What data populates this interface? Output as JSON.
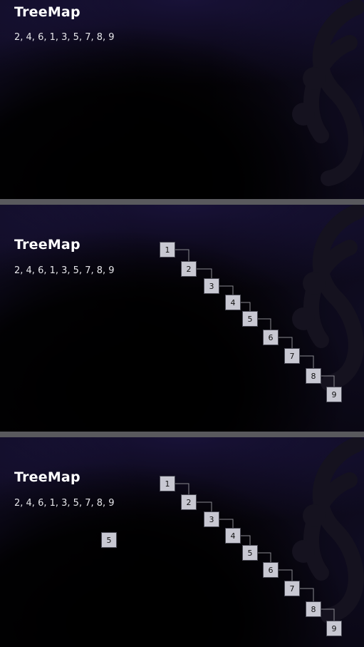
{
  "frames": [
    {
      "title": "TreeMap",
      "sequence": "2, 4, 6, 1, 3, 5, 7, 8, 9",
      "nodes": [],
      "highlight": null
    },
    {
      "title": "TreeMap",
      "sequence": "2, 4, 6, 1, 3, 5, 7, 8, 9",
      "nodes": [
        "1",
        "2",
        "3",
        "4",
        "5",
        "6",
        "7",
        "8",
        "9"
      ],
      "highlight": null
    },
    {
      "title": "TreeMap",
      "sequence": "2, 4, 6, 1, 3, 5, 7, 8, 9",
      "nodes": [
        "1",
        "2",
        "3",
        "4",
        "5",
        "6",
        "7",
        "8",
        "9"
      ],
      "highlight": "5"
    }
  ],
  "colors": {
    "node_fill": "#c8c8d2",
    "node_border": "#4a4a55",
    "edge": "#8a8a90",
    "title": "#ffffff",
    "background": "#050308"
  }
}
